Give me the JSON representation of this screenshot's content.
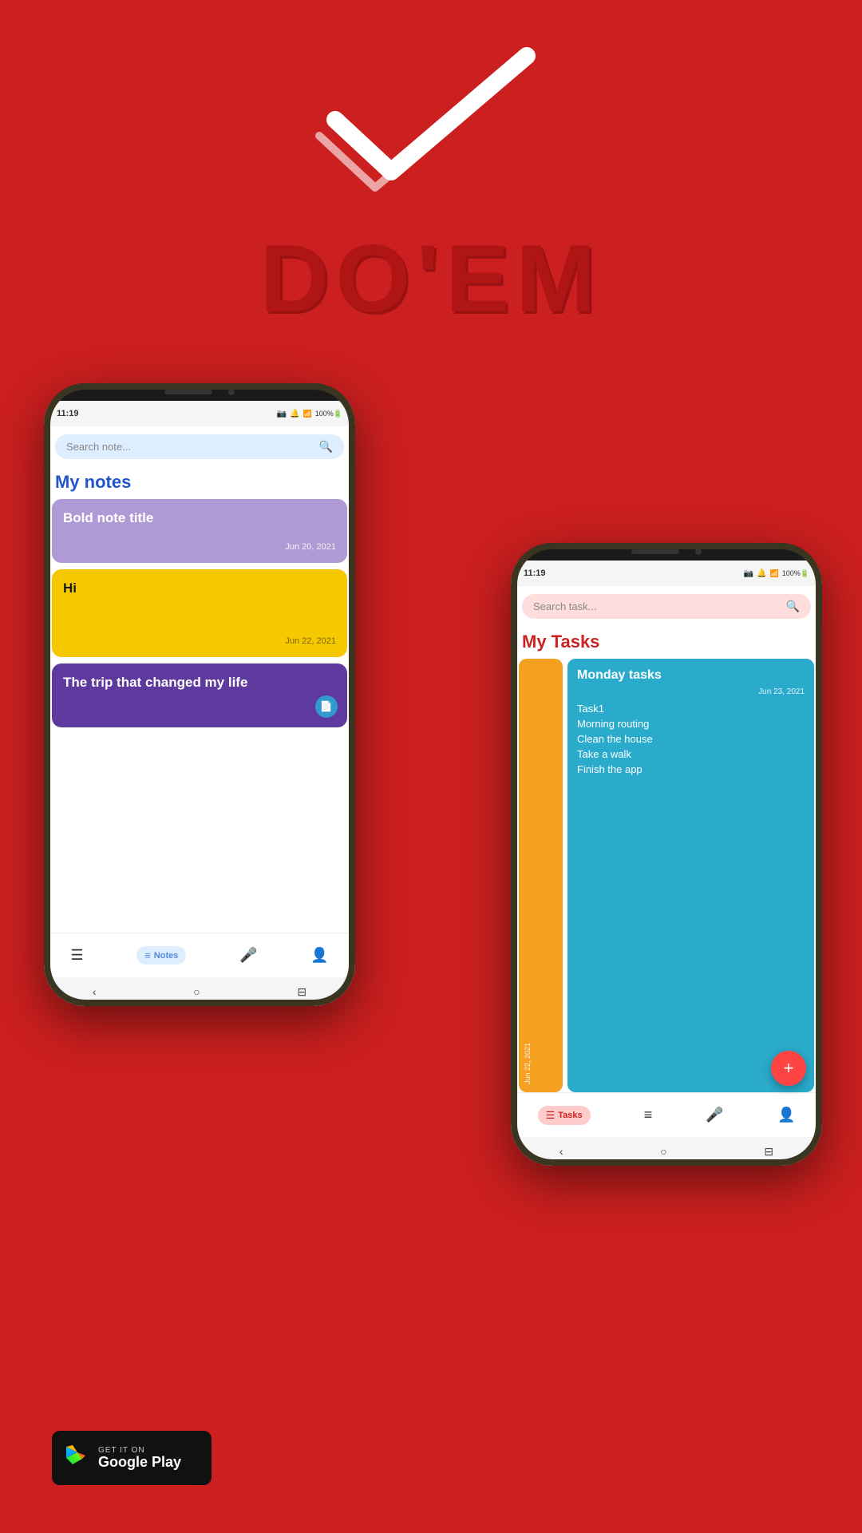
{
  "app": {
    "name": "DO'EM",
    "background_color": "#cc1f1f"
  },
  "logo": {
    "checkmark_color": "white"
  },
  "phone_left": {
    "status": {
      "time": "11:19",
      "icons": "📷 🔔 📶 100%"
    },
    "search": {
      "placeholder": "Search note...",
      "bg": "#ddeeff"
    },
    "section_title": "My notes",
    "notes": [
      {
        "id": 1,
        "title": "Bold note title",
        "date": "Jun 20, 2021",
        "color": "purple",
        "has_icon": false
      },
      {
        "id": 2,
        "title": "Hi",
        "date": "Jun 22, 2021",
        "color": "yellow",
        "has_icon": false
      },
      {
        "id": 3,
        "title": "The trip that changed my life",
        "date": "",
        "color": "dark-purple",
        "has_icon": true
      }
    ],
    "nav": {
      "items": [
        {
          "icon": "☰",
          "label": "",
          "type": "tasks"
        },
        {
          "icon": "≡",
          "label": "Notes",
          "type": "notes",
          "active": true
        },
        {
          "icon": "🎤",
          "label": "",
          "type": "mic"
        },
        {
          "icon": "👤",
          "label": "",
          "type": "profile"
        }
      ]
    }
  },
  "phone_right": {
    "status": {
      "time": "11:19",
      "icons": "📷 🔔 📶 100%"
    },
    "search": {
      "placeholder": "Search task...",
      "bg": "#fdd"
    },
    "section_title": "My Tasks",
    "tasks_card_left": {
      "date": "Jun 22, 2021",
      "color": "#f5a020"
    },
    "tasks_card_right": {
      "title": "Monday tasks",
      "date": "Jun 23, 2021",
      "color": "#2aabcc",
      "items": [
        "Task1",
        "Morning routing",
        "Clean the house",
        "Take a walk",
        "Finish the app"
      ]
    },
    "fab_icon": "+",
    "nav": {
      "items": [
        {
          "icon": "☰",
          "label": "Tasks",
          "type": "tasks",
          "active": true
        },
        {
          "icon": "≡",
          "label": "",
          "type": "notes"
        },
        {
          "icon": "🎤",
          "label": "",
          "type": "mic"
        },
        {
          "icon": "👤",
          "label": "",
          "type": "profile"
        }
      ]
    }
  },
  "play_store": {
    "get_it_on": "GET IT ON",
    "store_name": "Google Play"
  },
  "android_nav": {
    "back": "‹",
    "home": "○",
    "recent": "⊟"
  }
}
